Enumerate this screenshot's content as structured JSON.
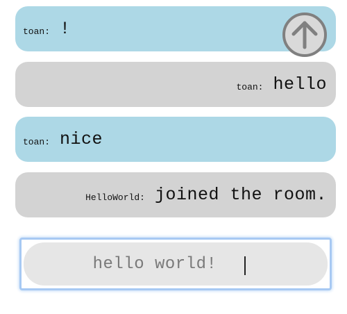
{
  "messages": [
    {
      "author": "toan:",
      "text": "!",
      "side": "left"
    },
    {
      "author": "toan:",
      "text": "hello",
      "side": "right"
    },
    {
      "author": "toan:",
      "text": "nice",
      "side": "left"
    },
    {
      "author": "HelloWorld:",
      "text": "joined the room.",
      "side": "right"
    }
  ],
  "composer": {
    "value": "hello world!",
    "send_icon": "arrow-up-circle-icon"
  },
  "colors": {
    "own_bubble": "#add8e6",
    "other_bubble": "#d3d3d3",
    "input_pill": "#e6e6e6",
    "focus_ring": "#a7c9f3",
    "send_icon": "#808080"
  }
}
